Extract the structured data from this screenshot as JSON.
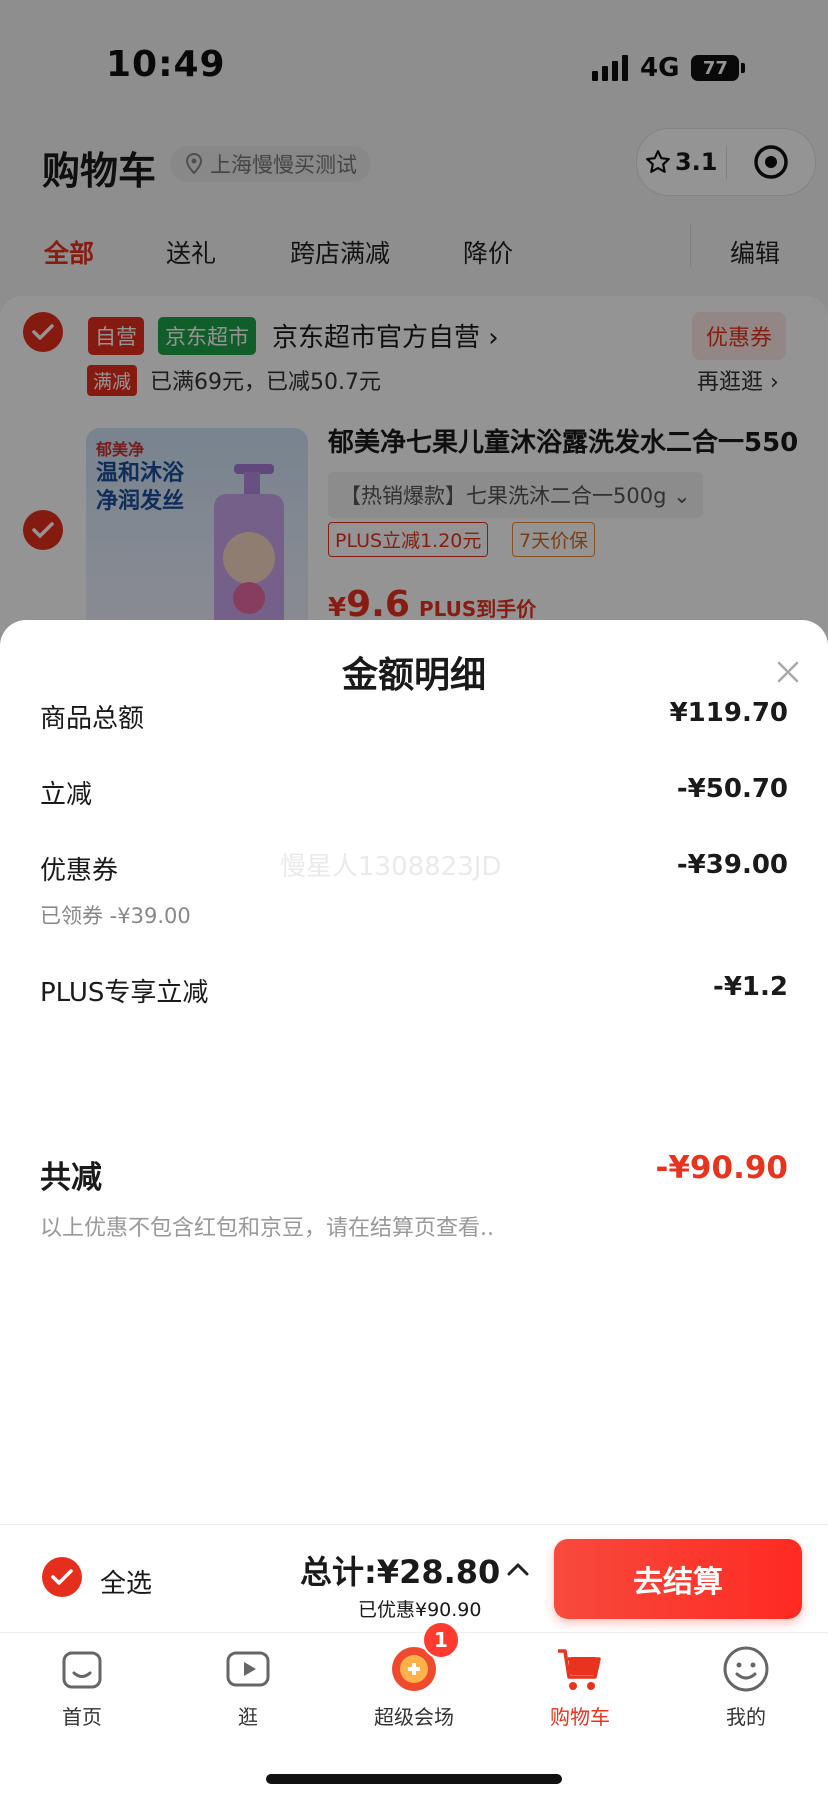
{
  "status_bar": {
    "time": "10:49",
    "network": "4G",
    "battery": "77"
  },
  "header": {
    "title": "购物车",
    "location": "上海慢慢买测试",
    "capsule_score": "3.1"
  },
  "tabs": [
    {
      "label": "全部"
    },
    {
      "label": "送礼"
    },
    {
      "label": "跨店满减"
    },
    {
      "label": "降价"
    },
    {
      "label": "编辑"
    }
  ],
  "shop": {
    "tag_self": "自营",
    "tag_store": "京东超市",
    "name": "京东超市官方自营",
    "coupon_button": "优惠券",
    "promo_tag": "满减",
    "promo_text": "已满69元，已减50.7元",
    "more_link": "再逛逛"
  },
  "product": {
    "title": "郁美净七果儿童沐浴露洗发水二合一550",
    "sku": "【热销爆款】七果洗沐二合一500g",
    "plus_tag": "PLUS立减1.20元",
    "guarantee_tag": "7天价保",
    "price_symbol": "¥",
    "price": "9.6",
    "price_note": "PLUS到手价",
    "image_text_1": "郁美净",
    "image_text_2": "温和沐浴",
    "image_text_3": "净润发丝"
  },
  "sheet": {
    "title": "金额明细",
    "rows": [
      {
        "label": "商品总额",
        "value": "¥119.70"
      },
      {
        "label": "立减",
        "value": "-¥50.70"
      },
      {
        "label": "优惠券",
        "value": "-¥39.00",
        "sub": "已领券 -¥39.00"
      },
      {
        "label": "PLUS专享立减",
        "value": "-¥1.2"
      }
    ],
    "total_label": "共减",
    "total_value": "-¥90.90",
    "disclaimer": "以上优惠不包含红包和京豆，请在结算页查看..",
    "watermark": "慢星人1308823JD"
  },
  "checkout": {
    "select_all": "全选",
    "total": "总计:¥28.80",
    "saved": "已优惠¥90.90",
    "button": "去结算"
  },
  "tabbar": [
    {
      "label": "首页"
    },
    {
      "label": "逛"
    },
    {
      "label": "超级会场",
      "badge": "1"
    },
    {
      "label": "购物车"
    },
    {
      "label": "我的"
    }
  ],
  "colors": {
    "accent": "#e8331f",
    "jd_green": "#1fa34a",
    "overlay": "rgba(0,0,0,0.42)"
  }
}
